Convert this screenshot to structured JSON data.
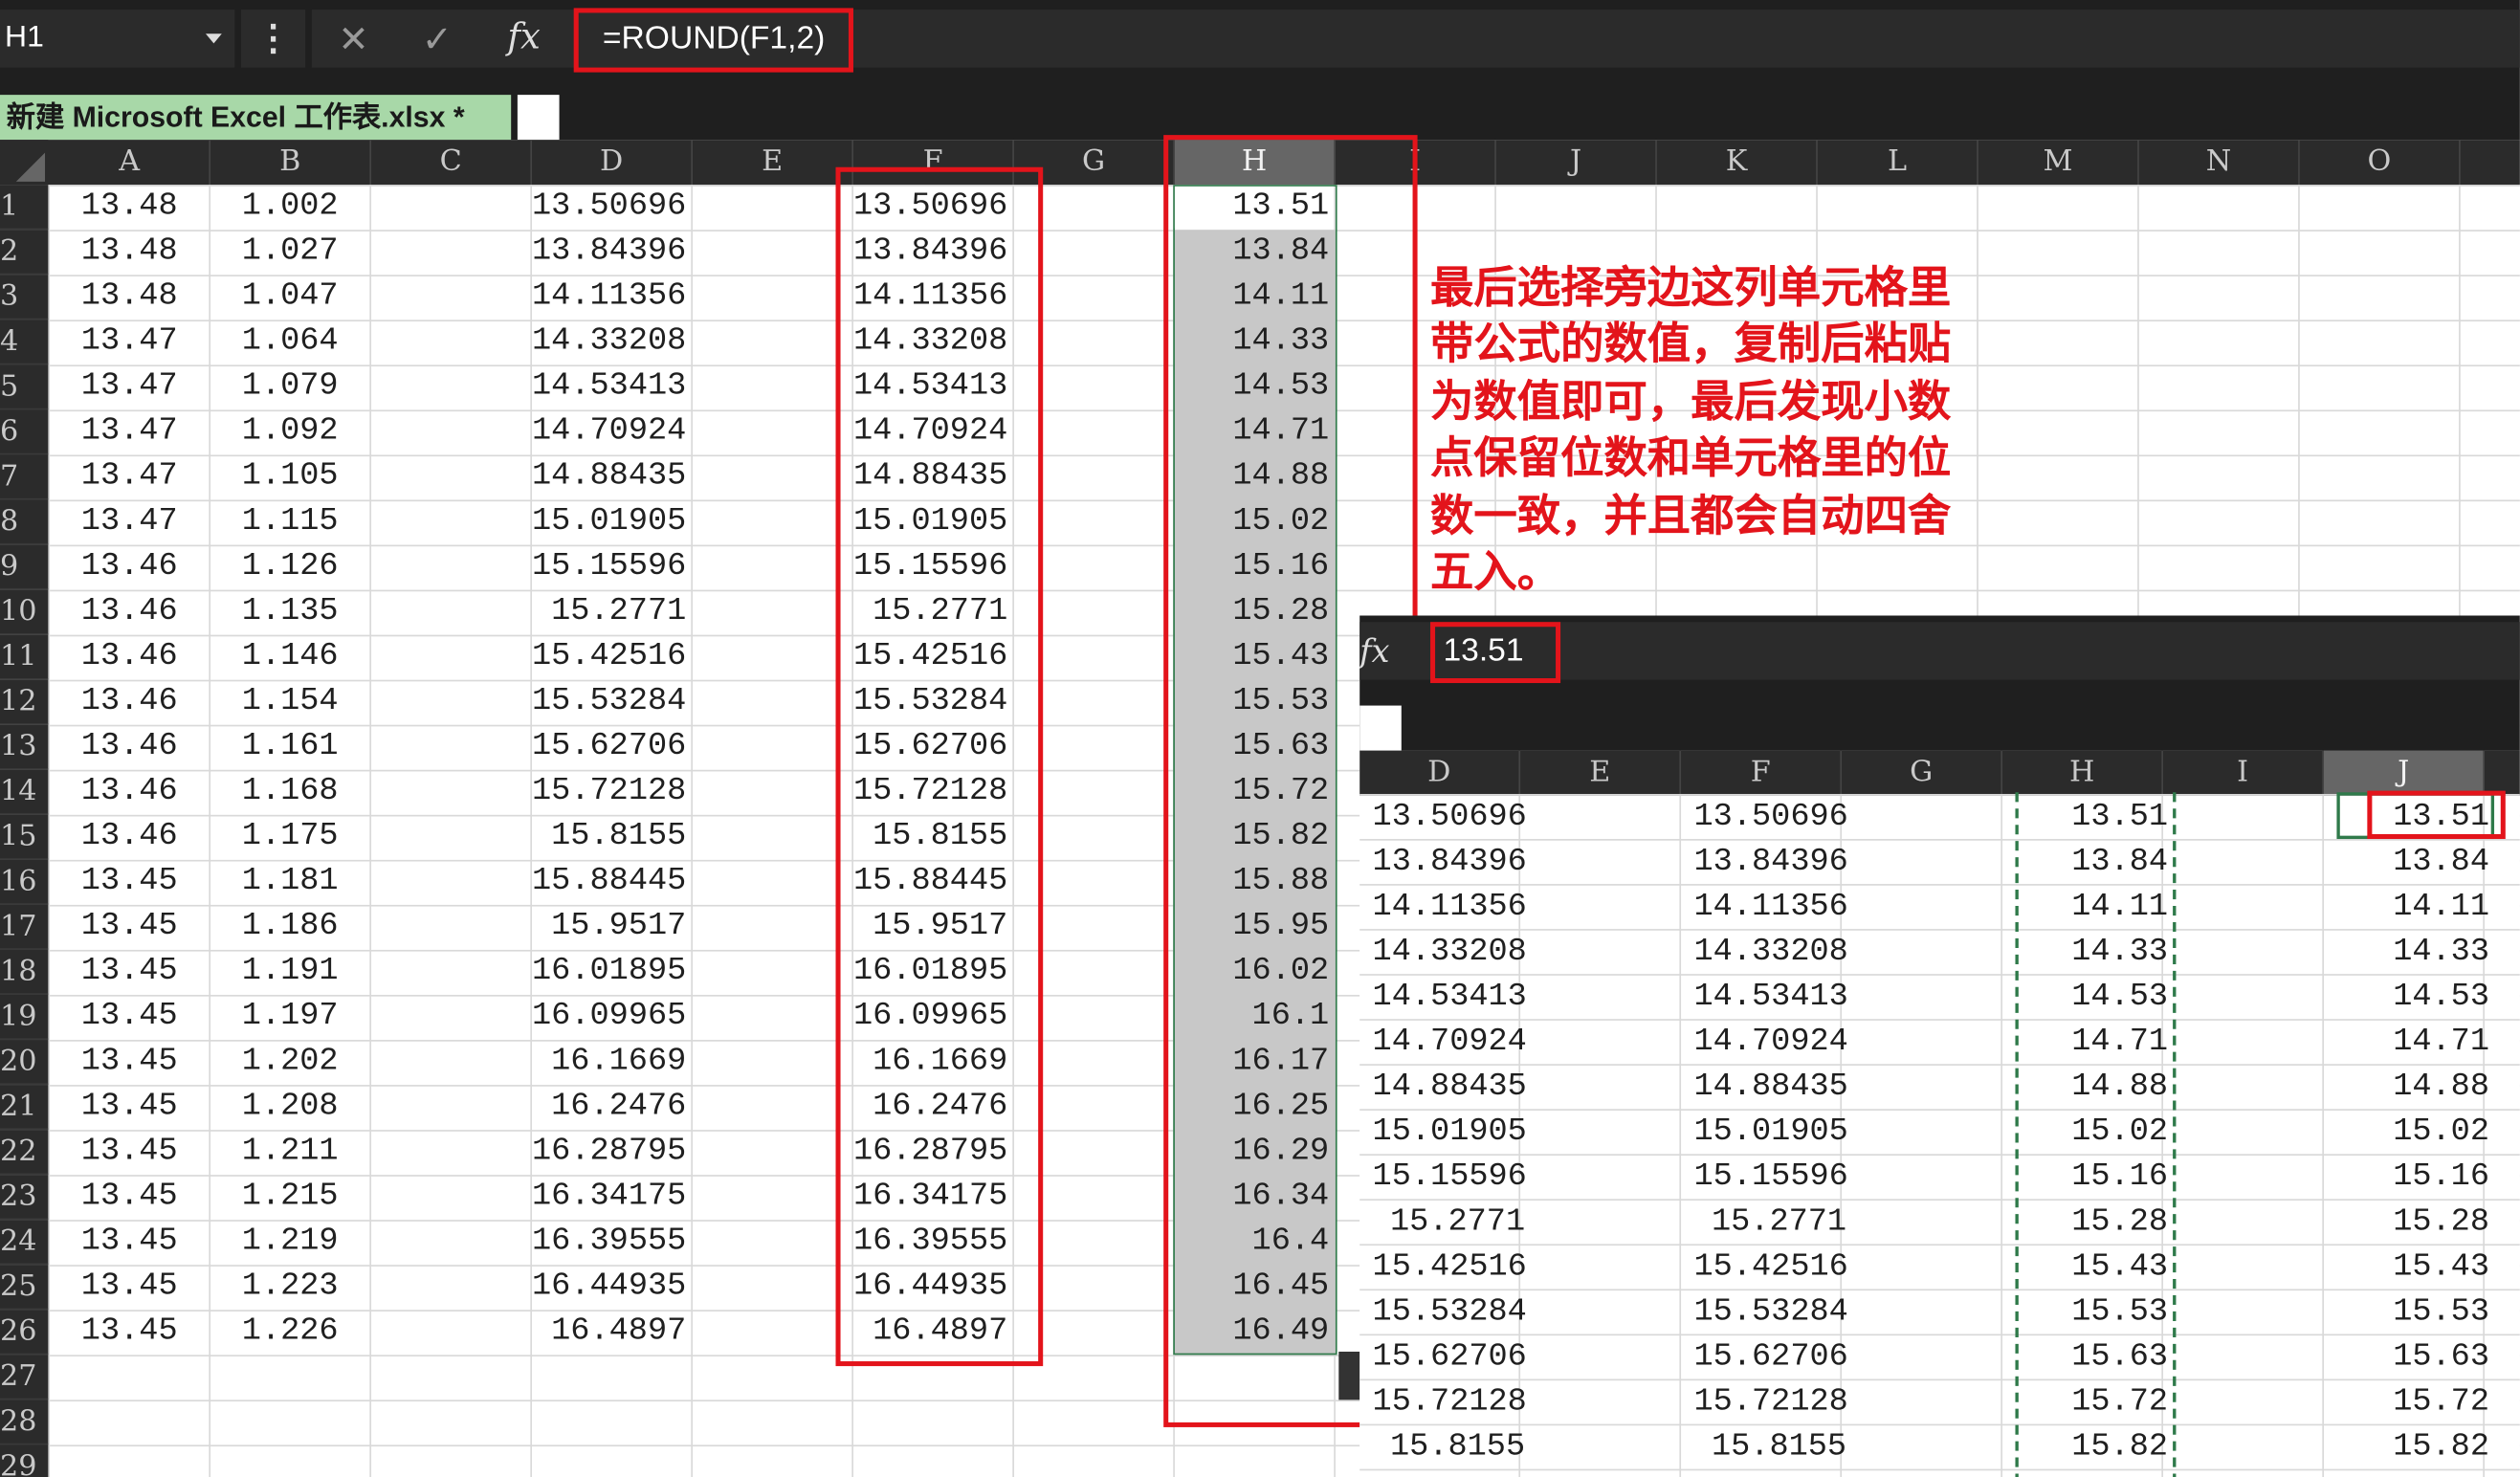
{
  "main": {
    "name_box": "H1",
    "formula": "=ROUND(F1,2)",
    "sheet_tab": "新建 Microsoft Excel 工作表.xlsx *",
    "columns": [
      "A",
      "B",
      "C",
      "D",
      "E",
      "F",
      "G",
      "H",
      "I",
      "J",
      "K",
      "L",
      "M",
      "N",
      "O"
    ],
    "row_numbers": [
      "1",
      "2",
      "3",
      "4",
      "5",
      "6",
      "7",
      "8",
      "9",
      "10",
      "11",
      "12",
      "13",
      "14",
      "15",
      "16",
      "17",
      "18",
      "19",
      "20",
      "21",
      "22",
      "23",
      "24",
      "25",
      "26",
      "27",
      "28",
      "29"
    ],
    "col_a": [
      "13.48",
      "13.48",
      "13.48",
      "13.47",
      "13.47",
      "13.47",
      "13.47",
      "13.47",
      "13.46",
      "13.46",
      "13.46",
      "13.46",
      "13.46",
      "13.46",
      "13.46",
      "13.45",
      "13.45",
      "13.45",
      "13.45",
      "13.45",
      "13.45",
      "13.45",
      "13.45",
      "13.45",
      "13.45",
      "13.45"
    ],
    "col_b": [
      "1.002",
      "1.027",
      "1.047",
      "1.064",
      "1.079",
      "1.092",
      "1.105",
      "1.115",
      "1.126",
      "1.135",
      "1.146",
      "1.154",
      "1.161",
      "1.168",
      "1.175",
      "1.181",
      "1.186",
      "1.191",
      "1.197",
      "1.202",
      "1.208",
      "1.211",
      "1.215",
      "1.219",
      "1.223",
      "1.226"
    ],
    "col_d": [
      "13.50696",
      "13.84396",
      "14.11356",
      "14.33208",
      "14.53413",
      "14.70924",
      "14.88435",
      "15.01905",
      "15.15596",
      "15.2771",
      "15.42516",
      "15.53284",
      "15.62706",
      "15.72128",
      "15.8155",
      "15.88445",
      "15.9517",
      "16.01895",
      "16.09965",
      "16.1669",
      "16.2476",
      "16.28795",
      "16.34175",
      "16.39555",
      "16.44935",
      "16.4897"
    ],
    "col_f": [
      "13.50696",
      "13.84396",
      "14.11356",
      "14.33208",
      "14.53413",
      "14.70924",
      "14.88435",
      "15.01905",
      "15.15596",
      "15.2771",
      "15.42516",
      "15.53284",
      "15.62706",
      "15.72128",
      "15.8155",
      "15.88445",
      "15.9517",
      "16.01895",
      "16.09965",
      "16.1669",
      "16.2476",
      "16.28795",
      "16.34175",
      "16.39555",
      "16.44935",
      "16.4897"
    ],
    "col_h": [
      "13.51",
      "13.84",
      "14.11",
      "14.33",
      "14.53",
      "14.71",
      "14.88",
      "15.02",
      "15.16",
      "15.28",
      "15.43",
      "15.53",
      "15.63",
      "15.72",
      "15.82",
      "15.88",
      "15.95",
      "16.02",
      "16.1",
      "16.17",
      "16.25",
      "16.29",
      "16.34",
      "16.4",
      "16.45",
      "16.49"
    ]
  },
  "annotation": [
    "最后选择旁边这列单元格里",
    "带公式的数值，复制后粘贴",
    "为数值即可，最后发现小数",
    "点保留位数和单元格里的位",
    "数一致，并且都会自动四舍",
    "五入。"
  ],
  "inset": {
    "formula": "13.51",
    "fx": "fx",
    "columns": [
      "D",
      "E",
      "F",
      "G",
      "H",
      "I",
      "J"
    ],
    "col_d": [
      "13.50696",
      "13.84396",
      "14.11356",
      "14.33208",
      "14.53413",
      "14.70924",
      "14.88435",
      "15.01905",
      "15.15596",
      "15.2771",
      "15.42516",
      "15.53284",
      "15.62706",
      "15.72128",
      "15.8155"
    ],
    "col_f": [
      "13.50696",
      "13.84396",
      "14.11356",
      "14.33208",
      "14.53413",
      "14.70924",
      "14.88435",
      "15.01905",
      "15.15596",
      "15.2771",
      "15.42516",
      "15.53284",
      "15.62706",
      "15.72128",
      "15.8155"
    ],
    "col_h": [
      "13.51",
      "13.84",
      "14.11",
      "14.33",
      "14.53",
      "14.71",
      "14.88",
      "15.02",
      "15.16",
      "15.28",
      "15.43",
      "15.53",
      "15.63",
      "15.72",
      "15.82"
    ],
    "col_j": [
      "13.51",
      "13.84",
      "14.11",
      "14.33",
      "14.53",
      "14.71",
      "14.88",
      "15.02",
      "15.16",
      "15.28",
      "15.43",
      "15.53",
      "15.63",
      "15.72",
      "15.82"
    ]
  },
  "colors": {
    "accent_red": "#e3141b",
    "tab_green": "#a8d8a8",
    "toolbar_dark": "#2b2b2b"
  }
}
